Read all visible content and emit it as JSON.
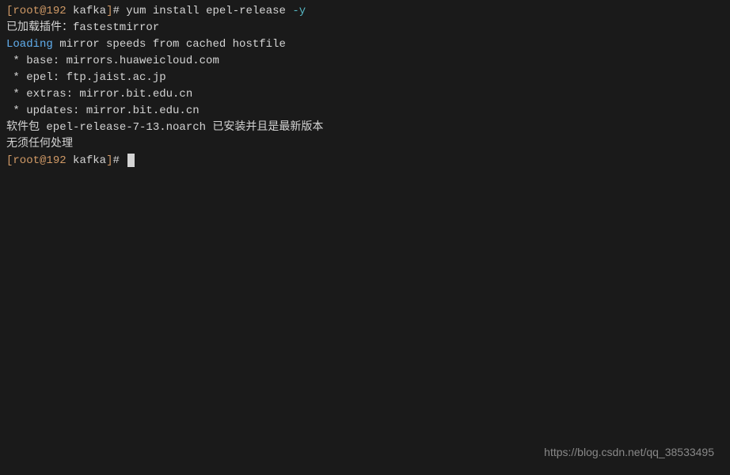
{
  "prompt": {
    "bracket_open": "[",
    "user": "root",
    "at": "@",
    "host": "192",
    "dir": " kafka",
    "bracket_close": "]",
    "hash": "# "
  },
  "command": {
    "cmd": "yum install epel-release ",
    "flag": "-y"
  },
  "output": {
    "line1": "已加载插件：fastestmirror",
    "line2_loading": "Loading",
    "line2_rest": " mirror speeds from cached hostfile",
    "line3": " * base: mirrors.huaweicloud.com",
    "line4": " * epel: ftp.jaist.ac.jp",
    "line5": " * extras: mirror.bit.edu.cn",
    "line6": " * updates: mirror.bit.edu.cn",
    "line7": "软件包 epel-release-7-13.noarch 已安装并且是最新版本",
    "line8": "无须任何处理"
  },
  "watermark": "https://blog.csdn.net/qq_38533495"
}
